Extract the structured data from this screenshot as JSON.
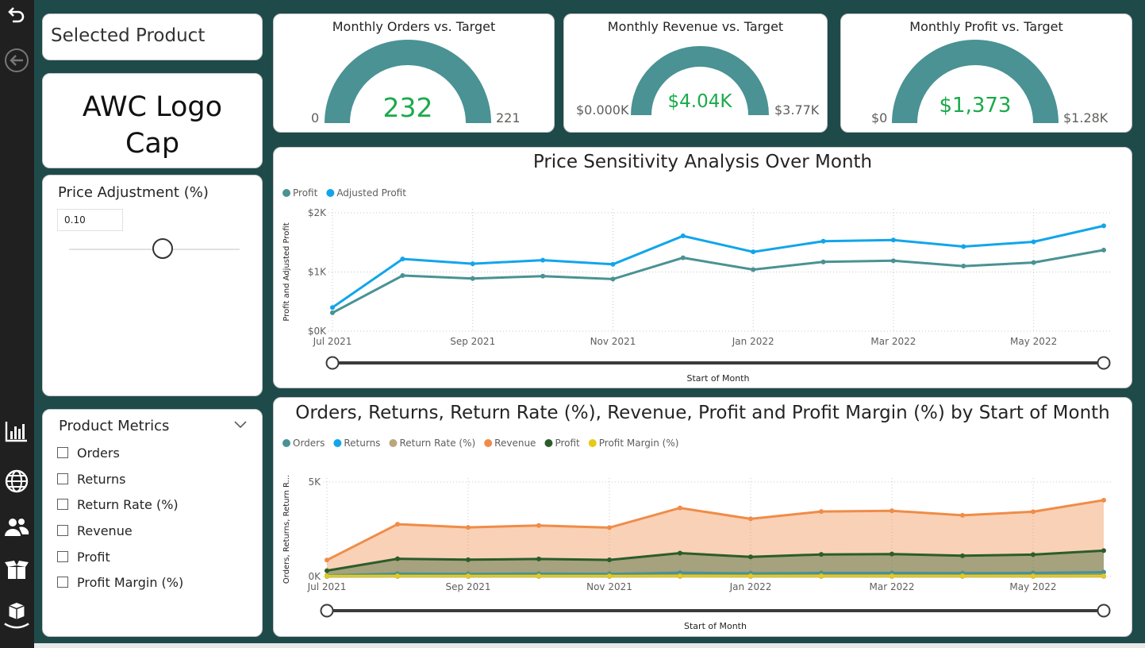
{
  "nav": {
    "icons": [
      "undo-icon",
      "back-arrow-icon",
      "bar-chart-icon",
      "globe-icon",
      "users-icon",
      "open-box-icon",
      "boxes-stack-icon"
    ]
  },
  "selected_product": {
    "title": "Selected Product",
    "name_line1": "AWC Logo",
    "name_line2": "Cap"
  },
  "price_adjustment": {
    "title": "Price Adjustment (%)",
    "value": "0.10",
    "slider_fraction": 0.55
  },
  "product_metrics": {
    "title": "Product Metrics",
    "options": [
      "Orders",
      "Returns",
      "Return Rate (%)",
      "Revenue",
      "Profit",
      "Profit Margin (%)"
    ]
  },
  "kpis": [
    {
      "title": "Monthly Orders vs. Target",
      "value": "232",
      "min": "0",
      "max": "221"
    },
    {
      "title": "Monthly Revenue vs. Target",
      "value": "$4.04K",
      "min": "$0.000K",
      "max": "$3.77K"
    },
    {
      "title": "Monthly Profit vs. Target",
      "value": "$1,373",
      "min": "$0",
      "max": "$1.28K"
    }
  ],
  "colors": {
    "teal": "#4a9294",
    "cyan": "#12a5eb",
    "orange": "#ef8c48",
    "dark_green": "#2b5d2a",
    "tan": "#b9a77e",
    "yellow": "#e8c917",
    "kpi_value": "#1aaa4b"
  },
  "chart_data": [
    {
      "type": "line",
      "title": "Price Sensitivity Analysis Over Month",
      "xlabel": "Start of Month",
      "ylabel": "Profit and Adjusted Profit",
      "x_ticks": [
        "Jul 2021",
        "Sep 2021",
        "Nov 2021",
        "Jan 2022",
        "Mar 2022",
        "May 2022"
      ],
      "y_ticks": [
        "$0K",
        "$1K",
        "$2K"
      ],
      "ylim": [
        0,
        2000
      ],
      "x": [
        "2021-07",
        "2021-08",
        "2021-09",
        "2021-10",
        "2021-11",
        "2021-12",
        "2022-01",
        "2022-02",
        "2022-03",
        "2022-04",
        "2022-05",
        "2022-06"
      ],
      "series": [
        {
          "name": "Profit",
          "color": "#4a9294",
          "values": [
            310,
            940,
            890,
            930,
            880,
            1240,
            1040,
            1170,
            1190,
            1100,
            1160,
            1370
          ]
        },
        {
          "name": "Adjusted Profit",
          "color": "#12a5eb",
          "values": [
            400,
            1220,
            1140,
            1200,
            1130,
            1610,
            1340,
            1520,
            1540,
            1430,
            1510,
            1780
          ]
        }
      ],
      "grid": true,
      "legend": "top-left"
    },
    {
      "type": "area",
      "title": "Orders, Returns, Return Rate (%), Revenue, Profit and Profit Margin (%) by Start of Month",
      "xlabel": "Start of Month",
      "ylabel": "Orders, Returns, Return R...",
      "x_ticks": [
        "Jul 2021",
        "Sep 2021",
        "Nov 2021",
        "Jan 2022",
        "Mar 2022",
        "May 2022"
      ],
      "y_ticks": [
        "0K",
        "5K"
      ],
      "ylim": [
        0,
        5000
      ],
      "x": [
        "2021-07",
        "2021-08",
        "2021-09",
        "2021-10",
        "2021-11",
        "2021-12",
        "2022-01",
        "2022-02",
        "2022-03",
        "2022-04",
        "2022-05",
        "2022-06"
      ],
      "series": [
        {
          "name": "Orders",
          "color": "#4a9294",
          "values": [
            60,
            150,
            140,
            150,
            140,
            200,
            170,
            190,
            190,
            180,
            190,
            232
          ]
        },
        {
          "name": "Returns",
          "color": "#12a5eb",
          "values": [
            5,
            10,
            10,
            10,
            10,
            15,
            12,
            14,
            14,
            13,
            14,
            16
          ]
        },
        {
          "name": "Return Rate (%)",
          "color": "#b9a77e",
          "values": [
            8,
            7,
            7,
            7,
            7,
            7,
            7,
            7,
            7,
            7,
            7,
            7
          ]
        },
        {
          "name": "Revenue",
          "color": "#ef8c48",
          "values": [
            870,
            2770,
            2600,
            2700,
            2590,
            3630,
            3050,
            3440,
            3480,
            3240,
            3430,
            4040
          ]
        },
        {
          "name": "Profit",
          "color": "#2b5d2a",
          "values": [
            310,
            940,
            890,
            930,
            880,
            1240,
            1040,
            1170,
            1190,
            1100,
            1160,
            1370
          ]
        },
        {
          "name": "Profit Margin (%)",
          "color": "#e8c917",
          "values": [
            34,
            34,
            34,
            34,
            34,
            34,
            34,
            34,
            34,
            34,
            34,
            34
          ]
        }
      ],
      "grid": true,
      "legend": "top-left"
    }
  ]
}
